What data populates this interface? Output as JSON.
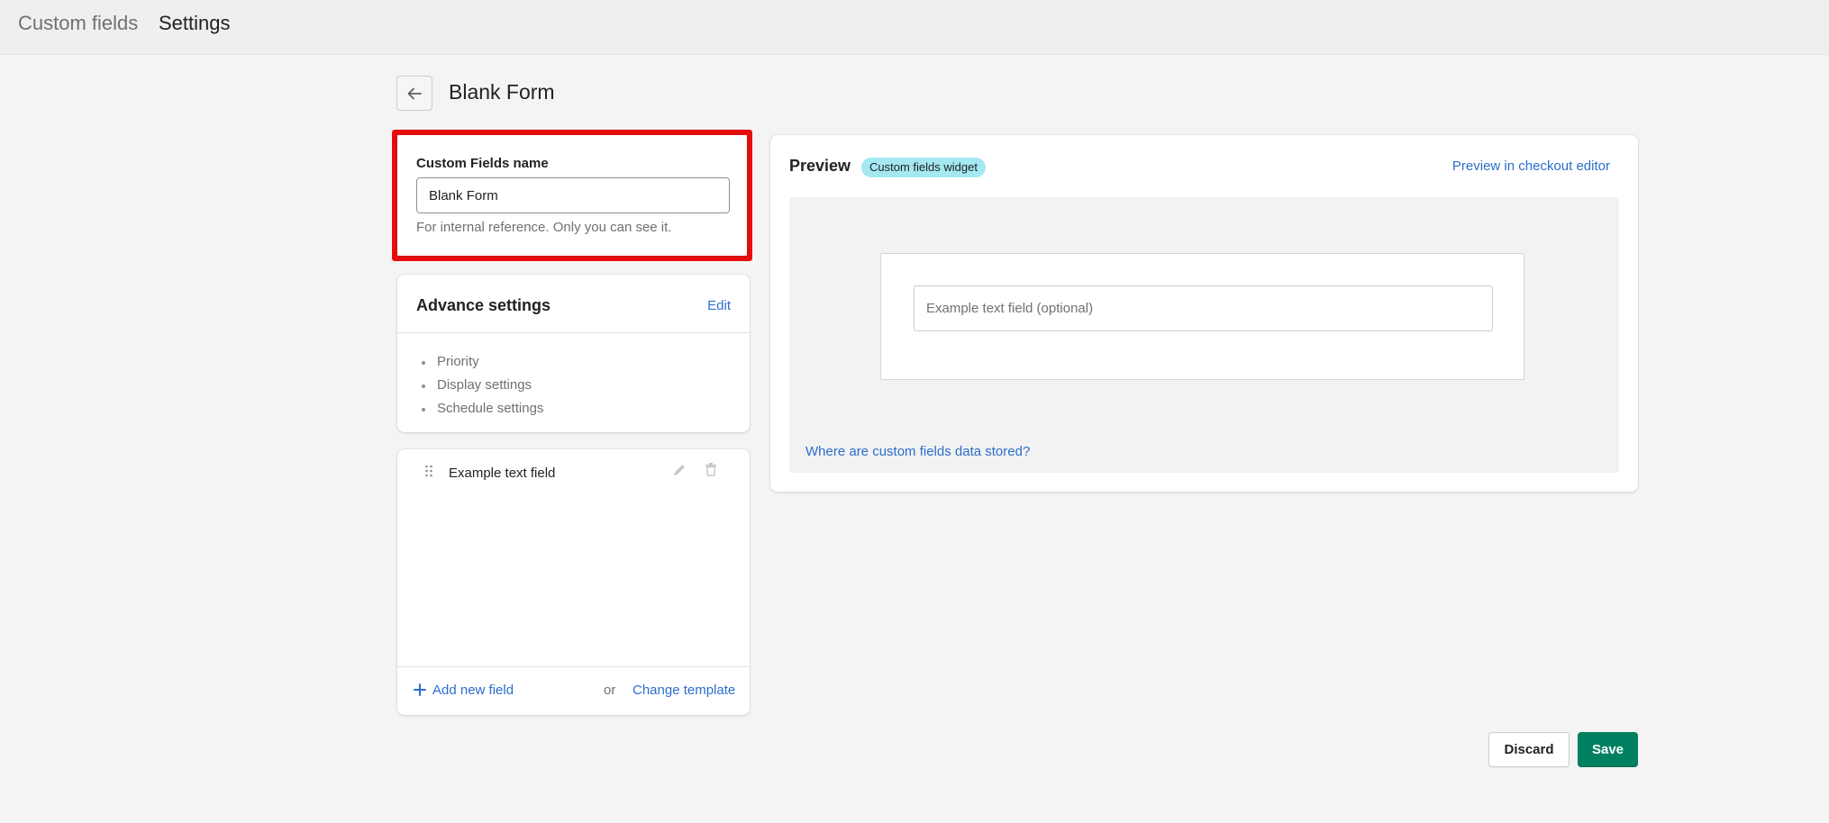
{
  "topbar": {
    "crumb_app": "Custom fields",
    "crumb_page": "Settings"
  },
  "header": {
    "title": "Blank Form"
  },
  "name_card": {
    "label": "Custom Fields name",
    "value": "Blank Form",
    "help": "For internal reference. Only you can see it."
  },
  "advance_settings": {
    "title": "Advance settings",
    "edit_label": "Edit",
    "items": [
      "Priority",
      "Display settings",
      "Schedule settings"
    ]
  },
  "fields": {
    "items": [
      {
        "label": "Example text field"
      }
    ],
    "add_label": "Add new field",
    "or_text": "or",
    "change_template_label": "Change template"
  },
  "preview": {
    "title": "Preview",
    "badge": "Custom fields widget",
    "checkout_link": "Preview in checkout editor",
    "input_placeholder": "Example text field (optional)",
    "stored_link": "Where are custom fields data stored?"
  },
  "actions": {
    "discard_label": "Discard",
    "save_label": "Save"
  },
  "colors": {
    "highlight": "#e80d0d",
    "link": "#2c6ecb",
    "primary": "#008060",
    "badge": "#a4e8f2"
  }
}
